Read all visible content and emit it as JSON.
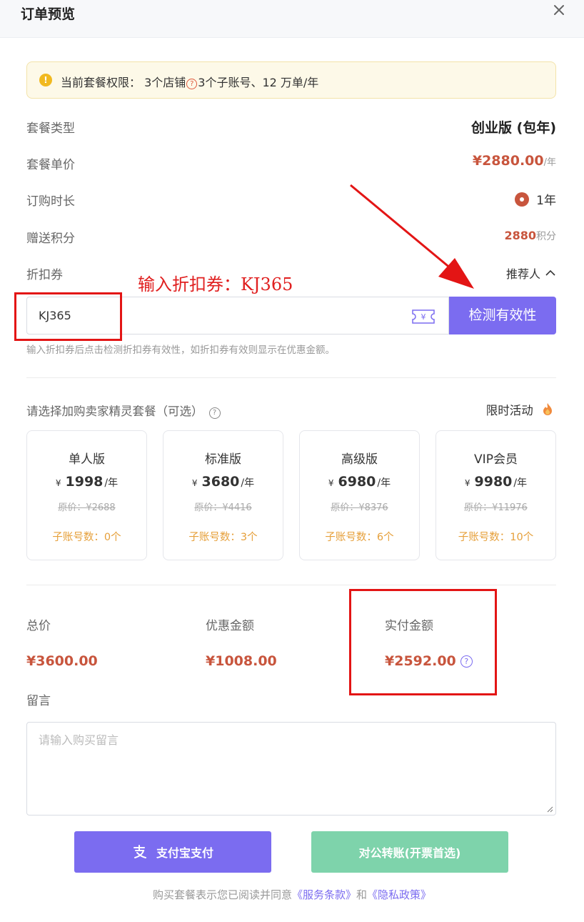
{
  "header": {
    "title": "订单预览",
    "close_icon": "close-icon"
  },
  "notice": {
    "prefix": "当前套餐权限： 3个店铺",
    "suffix": "3个子账号、12 万单/年",
    "q": "?"
  },
  "plan": {
    "type_label": "套餐类型",
    "type_value": "创业版 (包年)",
    "price_label": "套餐单价",
    "price_value": "¥2880.00",
    "price_unit": "/年",
    "duration_label": "订购时长",
    "duration_value": "1年",
    "points_label": "赠送积分",
    "points_value": "2880",
    "points_unit": "积分",
    "coupon_label": "折扣券",
    "referrer": "推荐人"
  },
  "annotation": {
    "text": "输入折扣券：KJ365",
    "color": "#e02020"
  },
  "coupon": {
    "value": "KJ365",
    "check_button": "检测有效性",
    "hint": "输入折扣券后点击检测折扣券有效性，如折扣券有效则显示在优惠金额。"
  },
  "addon": {
    "title": "请选择加购卖家精灵套餐（可选）",
    "limited": "限时活动",
    "cards": [
      {
        "name": "单人版",
        "yen": "¥",
        "price": "1998",
        "per": "/年",
        "orig": "原价：¥2688",
        "sub": "子账号数：0个"
      },
      {
        "name": "标准版",
        "yen": "¥",
        "price": "3680",
        "per": "/年",
        "orig": "原价：¥4416",
        "sub": "子账号数：3个"
      },
      {
        "name": "高级版",
        "yen": "¥",
        "price": "6980",
        "per": "/年",
        "orig": "原价：¥8376",
        "sub": "子账号数：6个"
      },
      {
        "name": "VIP会员",
        "yen": "¥",
        "price": "9980",
        "per": "/年",
        "orig": "原价：¥11976",
        "sub": "子账号数：10个"
      }
    ]
  },
  "summary": {
    "total_label": "总价",
    "total_value": "¥3600.00",
    "discount_label": "优惠金额",
    "discount_value": "¥1008.00",
    "paid_label": "实付金额",
    "paid_value": "¥2592.00",
    "q": "?"
  },
  "message": {
    "label": "留言",
    "placeholder": "请输入购买留言"
  },
  "buttons": {
    "alipay": "支付宝支付",
    "corporate": "对公转账(开票首选)"
  },
  "footer": {
    "prefix": "购买套餐表示您已阅读并同意",
    "terms": "《服务条款》",
    "and": "和",
    "privacy": "《隐私政策》"
  },
  "colors": {
    "accent": "#7b6cf0",
    "price": "#c8553d",
    "alipay_bg": "#7b6cf0",
    "corp_bg": "#7ed3ab",
    "orange": "#e6a03b",
    "annotation_red": "#e31515"
  }
}
